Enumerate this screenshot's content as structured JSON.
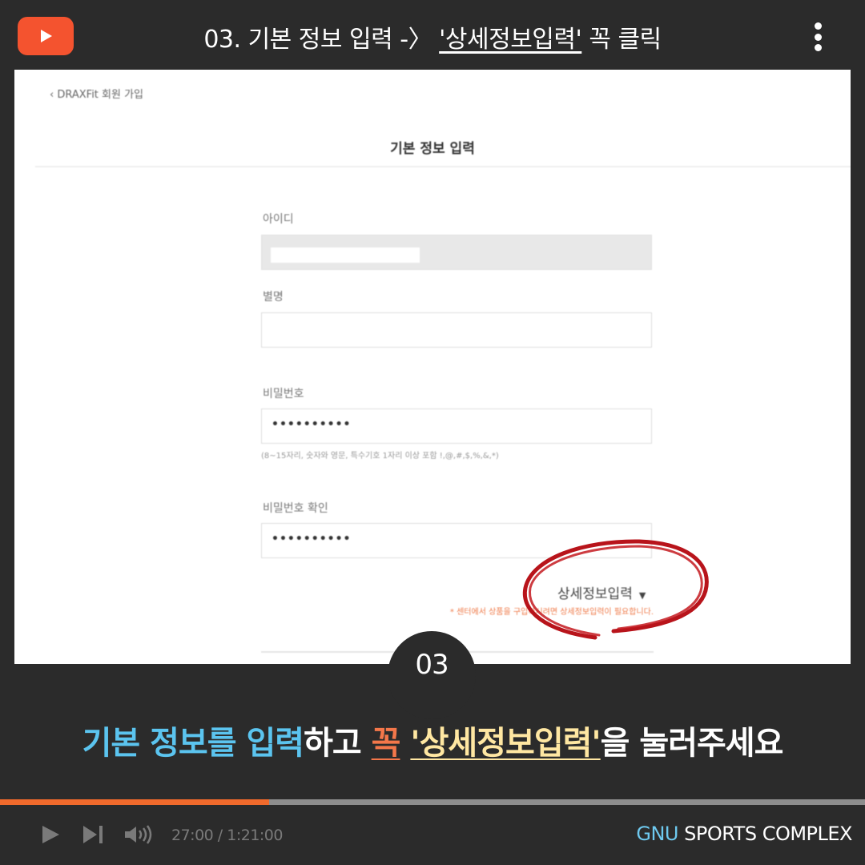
{
  "header": {
    "title_prefix": "03. 기본 정보 입력 -〉",
    "title_highlight": "'상세정보입력'",
    "title_suffix": "꼭 클릭"
  },
  "icons": {
    "logo": "youtube-play-icon",
    "menu": "more-vertical-icon"
  },
  "screenshot": {
    "back_link": "DRAXFit 회원 가입",
    "page_title": "기본 정보 입력",
    "fields": {
      "id_label": "아이디",
      "nickname_label": "별명",
      "password_label": "비밀번호",
      "password_value": "••••••••••",
      "password_hint": "(8~15자리, 숫자와 영문, 특수기호 1자리 이상 포함 !,@,#,$,%,&,*)",
      "password_confirm_label": "비밀번호 확인",
      "password_confirm_value": "••••••••••"
    },
    "detail_button": "상세정보입력",
    "detail_note": "* 센터에서 상품을 구입하시려면 상세정보입력이 필요합니다."
  },
  "step": {
    "number": "03"
  },
  "caption": {
    "part1": "기본 정보를",
    "part2": "입력",
    "part3": "하고",
    "part4": "꼭",
    "part5": "'상세정보입력'",
    "part6": "을 눌러주세요"
  },
  "player": {
    "progress_fraction": 0.311,
    "time": "27:00 / 1:21:00",
    "brand_accent": "GNU",
    "brand_rest": "SPORTS COMPLEX"
  },
  "colors": {
    "background": "#2b2b2b",
    "accent_orange": "#f06a2c",
    "caption_blue": "#5bc4ef",
    "caption_yellow": "#ffe7a2",
    "circle_red": "#b8141b"
  }
}
